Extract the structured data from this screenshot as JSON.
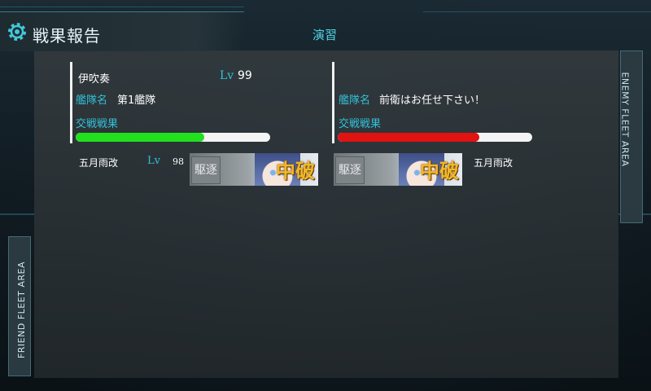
{
  "header": {
    "title": "戦果報告",
    "mode": "演習"
  },
  "side_tabs": {
    "enemy": "ENEMY FLEET AREA",
    "friend": "FRIEND FLEET AREA"
  },
  "friend": {
    "admiral": "伊吹奏",
    "lv_label": "Lv",
    "lv": "99",
    "fleet_name_label": "艦隊名",
    "fleet_name": "第1艦隊",
    "battle_result_label": "交戦戦果",
    "gauge_fraction": 0.66,
    "gauge_color": "#22e01e",
    "ships": [
      {
        "name": "五月雨改",
        "lv_label": "Lv",
        "lv": "98",
        "type_label": "駆逐",
        "damage": "中破"
      }
    ]
  },
  "enemy": {
    "fleet_name_label": "艦隊名",
    "fleet_name": "前衛はお任せ下さい！",
    "battle_result_label": "交戦戦果",
    "gauge_fraction": 0.73,
    "gauge_color": "#e01212",
    "ships": [
      {
        "name": "五月雨改",
        "type_label": "駆逐",
        "damage": "中破"
      }
    ]
  },
  "colors": {
    "accent": "#32c0d6",
    "panel": "#2f383c"
  }
}
